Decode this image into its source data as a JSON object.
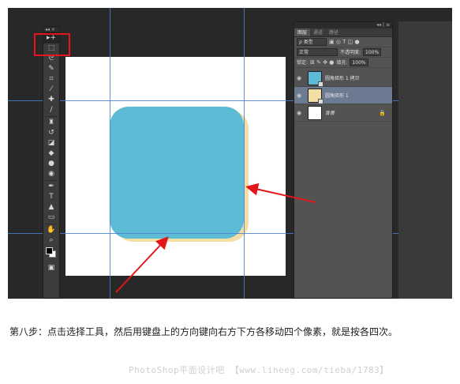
{
  "toolbar": {
    "header": "◂◂ ×",
    "tools": [
      {
        "name": "move-tool",
        "glyph": "▸+"
      },
      {
        "name": "marquee-tool",
        "glyph": "⬚"
      },
      {
        "name": "lasso-tool",
        "glyph": "ᘓ"
      },
      {
        "name": "quick-select-tool",
        "glyph": "✎"
      },
      {
        "name": "crop-tool",
        "glyph": "⌗"
      },
      {
        "name": "eyedropper-tool",
        "glyph": "⁄"
      },
      {
        "name": "healing-brush-tool",
        "glyph": "✚"
      },
      {
        "name": "brush-tool",
        "glyph": "∕"
      },
      {
        "name": "stamp-tool",
        "glyph": "♜"
      },
      {
        "name": "history-brush-tool",
        "glyph": "↺"
      },
      {
        "name": "eraser-tool",
        "glyph": "◪"
      },
      {
        "name": "paint-bucket-tool",
        "glyph": "◆"
      },
      {
        "name": "blur-tool",
        "glyph": "●"
      },
      {
        "name": "dodge-tool",
        "glyph": "◉"
      },
      {
        "name": "pen-tool",
        "glyph": "✒"
      },
      {
        "name": "type-tool",
        "glyph": "T"
      },
      {
        "name": "path-select-tool",
        "glyph": "▲"
      },
      {
        "name": "shape-tool",
        "glyph": "▭"
      },
      {
        "name": "hand-tool",
        "glyph": "✋"
      },
      {
        "name": "zoom-tool",
        "glyph": "⌕"
      }
    ],
    "bottom_glyph": "▣"
  },
  "panel": {
    "top_controls": "◂◂ | ≡",
    "tabs": [
      "图层",
      "通道",
      "路径"
    ],
    "kind_filter": "ρ 类型",
    "filter_icons": "▣ ◎ T ◫ ●",
    "blend_mode": "正常",
    "opacity_label": "不透明度:",
    "opacity_value": "100%",
    "lock_label": "锁定:",
    "lock_icons": "⊠ ✎ ✥ ●",
    "fill_label": "填充:",
    "fill_value": "100%",
    "layers": [
      {
        "name": "圆角矩形 1 拷贝",
        "selected": false
      },
      {
        "name": "圆角矩形 1",
        "selected": true
      },
      {
        "name": "背景",
        "selected": false,
        "lock": "🔒"
      }
    ]
  },
  "caption": "第八步：点击选择工具，然后用键盘上的方向键向右方下方各移动四个像素，就是按各四次。",
  "watermark": "PhotoShop平面设计吧 【www.lineeg.com/tieba/1783】",
  "colors": {
    "shape_blue": "#5dbbd5",
    "shape_yellow": "#f3dfa6",
    "guide": "#4a7bd0",
    "annotation_red": "#e3161b"
  }
}
